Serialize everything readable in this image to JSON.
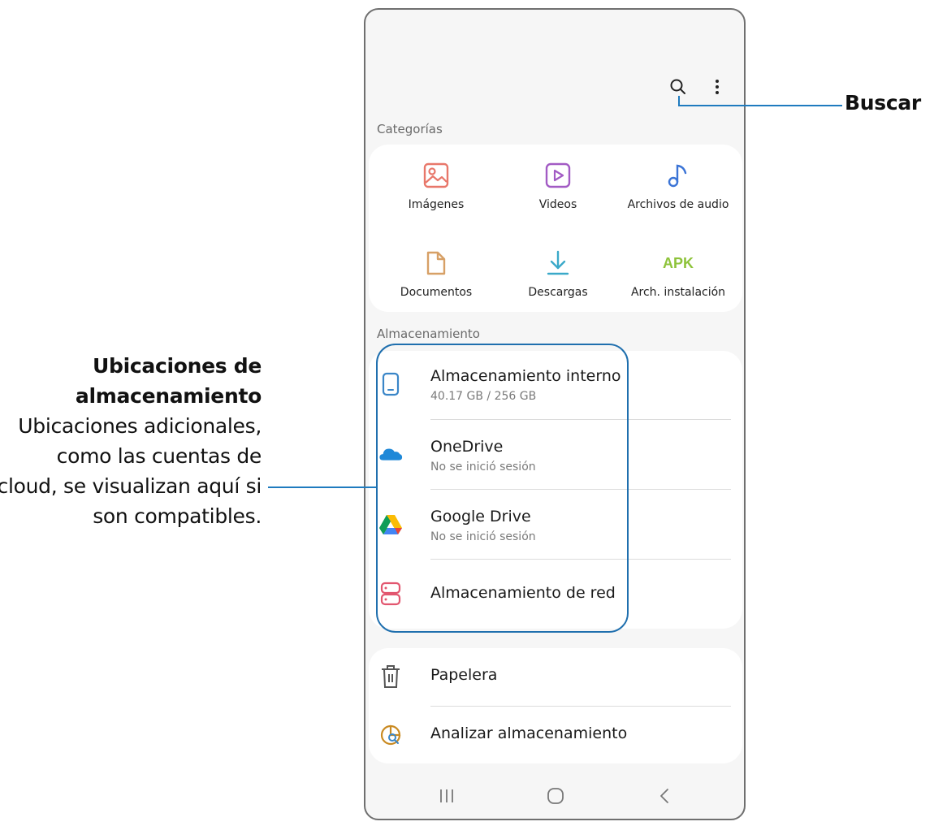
{
  "callouts": {
    "search": "Buscar",
    "storage_title": "Ubicaciones de almacenamiento",
    "storage_desc": "Ubicaciones adicionales, como las cuentas de cloud, se visualizan aquí si son compatibles."
  },
  "categories_section": {
    "title": "Categorías",
    "items": [
      {
        "label": "Imágenes",
        "icon": "image-icon",
        "color": "#e8776a"
      },
      {
        "label": "Videos",
        "icon": "video-icon",
        "color": "#a25bc4"
      },
      {
        "label": "Archivos de audio",
        "icon": "music-note-icon",
        "color": "#3b74d6"
      },
      {
        "label": "Documentos",
        "icon": "document-icon",
        "color": "#d7a066"
      },
      {
        "label": "Descargas",
        "icon": "download-icon",
        "color": "#3aa9c9"
      },
      {
        "label": "Arch. instalación",
        "icon": "apk-icon",
        "icon_text": "APK",
        "color": "#8ec33b"
      }
    ]
  },
  "storage_section": {
    "title": "Almacenamiento",
    "items": [
      {
        "title": "Almacenamiento interno",
        "subtitle": "40.17 GB / 256 GB",
        "icon": "phone-icon",
        "color": "#3a86c8"
      },
      {
        "title": "OneDrive",
        "subtitle": "No se inició sesión",
        "icon": "onedrive-icon",
        "color": "#1e88d8"
      },
      {
        "title": "Google Drive",
        "subtitle": "No se inició sesión",
        "icon": "google-drive-icon"
      },
      {
        "title": "Almacenamiento de red",
        "subtitle": "",
        "icon": "network-storage-icon",
        "color": "#e2566f"
      }
    ]
  },
  "tools_section": {
    "items": [
      {
        "title": "Papelera",
        "icon": "trash-icon",
        "color": "#555555"
      },
      {
        "title": "Analizar almacenamiento",
        "icon": "analyze-storage-icon",
        "color": "#c98a22"
      }
    ]
  },
  "colors": {
    "callout_line": "#1f7bbf",
    "highlight_border": "#1f6fae"
  }
}
